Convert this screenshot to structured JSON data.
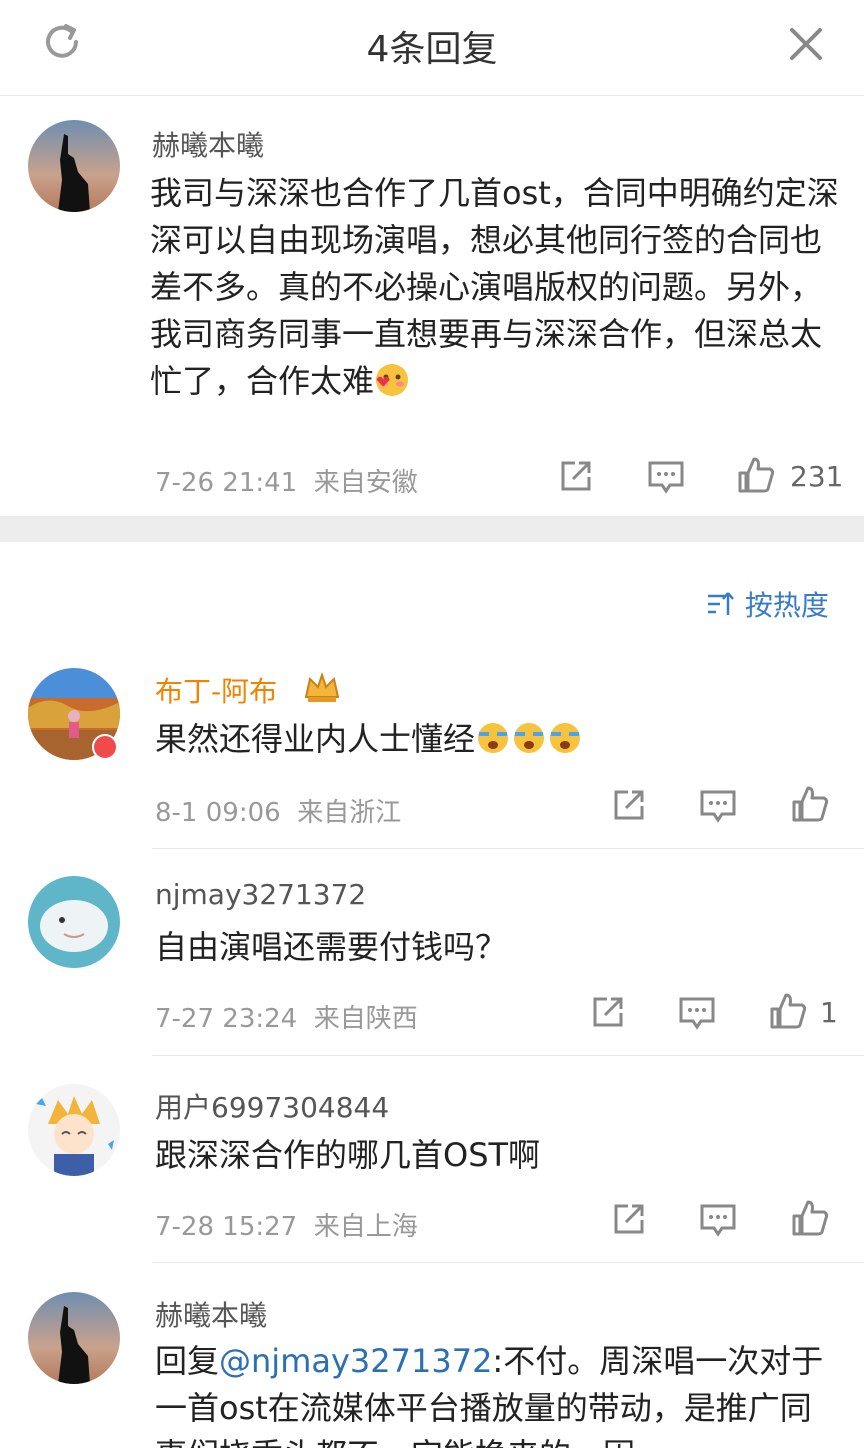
{
  "header": {
    "title": "4条回复"
  },
  "root_comment": {
    "user": "赫曦本曦",
    "text": "我司与深深也合作了几首ost，合同中明确约定深深可以自由现场演唱，想必其他同行签的合同也差不多。真的不必操心演唱版权的问题。另外，我司商务同事一直想要再与深深合作，但深总太忙了，合作太难",
    "time": "7-26 21:41",
    "location": "来自安徽",
    "likes": "231"
  },
  "sort": {
    "label": "按热度"
  },
  "replies": [
    {
      "user": "布丁-阿布",
      "text": "果然还得业内人士懂经",
      "time": "8-1 09:06",
      "location": "来自浙江",
      "likes": ""
    },
    {
      "user": "njmay3271372",
      "text": "自由演唱还需要付钱吗？",
      "time": "7-27 23:24",
      "location": "来自陕西",
      "likes": "1"
    },
    {
      "user": "用户6997304844",
      "text": "跟深深合作的哪几首OST啊",
      "time": "7-28 15:27",
      "location": "来自上海",
      "likes": ""
    },
    {
      "user": "赫曦本曦",
      "reply_prefix": "回复",
      "mention": "@njmay3271372",
      "text": ":不付。周深唱一次对于一首ost在流媒体平台播放量的带动，是推广同事们挠秃头都不一定能换来的。因"
    }
  ],
  "colors": {
    "accent": "#3a7bc8",
    "vip_name": "#f08300",
    "mention": "#2d6fb4"
  },
  "icons": [
    "refresh-icon",
    "close-icon",
    "share-icon",
    "comment-icon",
    "like-icon",
    "sort-icon"
  ]
}
